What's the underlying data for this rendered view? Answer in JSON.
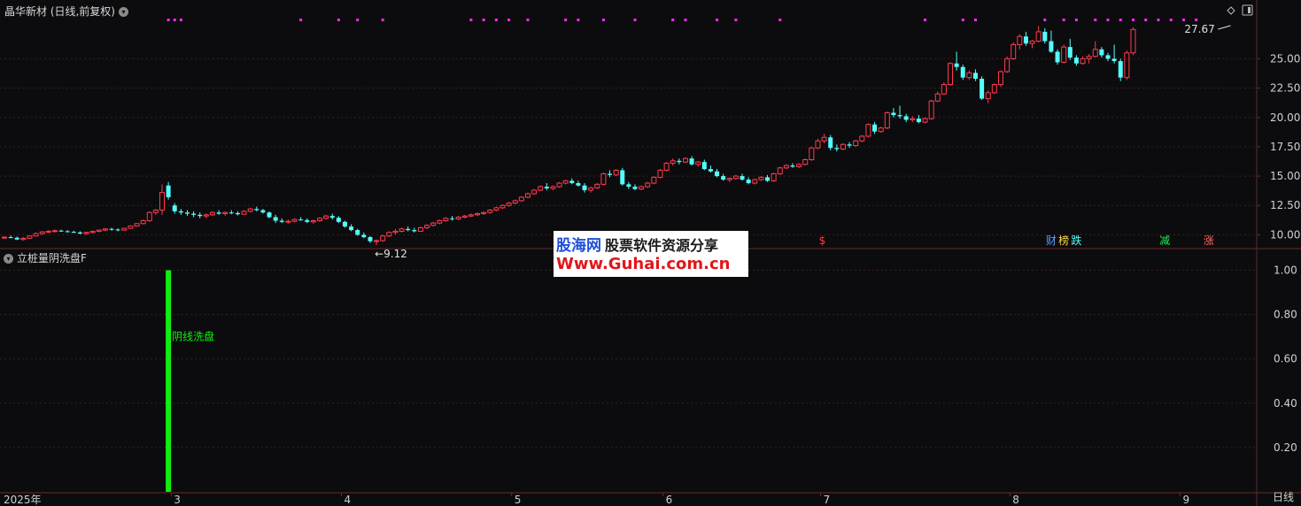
{
  "header": {
    "title": "晶华新材 (日线,前复权)",
    "indicator_title": "立桩量阴洗盘F"
  },
  "watermark": {
    "brand": "股海网",
    "tagline": "股票软件资源分享",
    "url": "Www.Guhai.com.cn"
  },
  "period_label": "日线",
  "colors": {
    "background": "#0c0c0e",
    "up": "#ff3b4e",
    "down": "#54ffff",
    "signal_dot": "#ff2bff",
    "indicator_bar": "#10f010",
    "grid": "#3a1e1e",
    "axis_text": "#d0d0d0"
  },
  "chart_data": [
    {
      "type": "candlestick",
      "title": "晶华新材 (日线,前复权)",
      "yticks": [
        10.0,
        12.5,
        15.0,
        17.5,
        20.0,
        22.5,
        25.0
      ],
      "ylim": [
        8.9,
        28.5
      ],
      "x_labels": [
        "2025年",
        "3",
        "4",
        "5",
        "6",
        "7",
        "8",
        "9"
      ],
      "x_label_index": [
        0,
        27,
        54,
        81,
        105,
        130,
        160,
        187
      ],
      "price_annotations": [
        {
          "text": "←9.12",
          "value": 9.12,
          "index": 59
        },
        {
          "text": "27.67",
          "value": 27.67,
          "index": 195
        }
      ],
      "event_markers": [
        {
          "text": "$",
          "index": 130,
          "color": "#ff3b3b"
        },
        {
          "text": "财",
          "index": 166,
          "color": "#5aa0ff"
        },
        {
          "text": "榜",
          "index": 168,
          "color": "#ffd84a"
        },
        {
          "text": "跌",
          "index": 170,
          "color": "#54ffff"
        },
        {
          "text": "减",
          "index": 184,
          "color": "#22ee55"
        },
        {
          "text": "涨",
          "index": 191,
          "color": "#ff6666"
        }
      ],
      "signal_dot_indices": [
        26,
        27,
        28,
        47,
        53,
        56,
        60,
        74,
        76,
        78,
        80,
        83,
        89,
        91,
        95,
        100,
        106,
        108,
        113,
        116,
        123,
        146,
        152,
        154,
        165,
        168,
        170,
        173,
        175,
        177,
        179,
        181,
        183,
        185,
        187,
        189
      ],
      "ohlc": [
        [
          9.75,
          9.85,
          9.65,
          9.8
        ],
        [
          9.8,
          9.95,
          9.7,
          9.75
        ],
        [
          9.75,
          9.85,
          9.55,
          9.6
        ],
        [
          9.6,
          9.8,
          9.5,
          9.7
        ],
        [
          9.7,
          9.95,
          9.65,
          9.9
        ],
        [
          9.9,
          10.2,
          9.85,
          10.1
        ],
        [
          10.1,
          10.3,
          10.0,
          10.25
        ],
        [
          10.25,
          10.4,
          10.15,
          10.3
        ],
        [
          10.3,
          10.45,
          10.2,
          10.35
        ],
        [
          10.35,
          10.45,
          10.25,
          10.3
        ],
        [
          10.3,
          10.4,
          10.2,
          10.25
        ],
        [
          10.25,
          10.35,
          10.15,
          10.2
        ],
        [
          10.2,
          10.3,
          10.05,
          10.1
        ],
        [
          10.1,
          10.25,
          10.0,
          10.2
        ],
        [
          10.2,
          10.35,
          10.1,
          10.3
        ],
        [
          10.3,
          10.45,
          10.2,
          10.4
        ],
        [
          10.4,
          10.55,
          10.3,
          10.5
        ],
        [
          10.5,
          10.6,
          10.35,
          10.45
        ],
        [
          10.45,
          10.55,
          10.3,
          10.4
        ],
        [
          10.4,
          10.6,
          10.35,
          10.55
        ],
        [
          10.55,
          10.8,
          10.5,
          10.75
        ],
        [
          10.75,
          11.0,
          10.7,
          10.95
        ],
        [
          10.95,
          11.3,
          10.9,
          11.2
        ],
        [
          11.2,
          12.0,
          11.1,
          11.9
        ],
        [
          11.9,
          12.2,
          11.7,
          12.1
        ],
        [
          12.1,
          14.3,
          11.7,
          13.6
        ],
        [
          14.2,
          14.5,
          13.0,
          13.2
        ],
        [
          12.5,
          12.7,
          11.8,
          12.0
        ],
        [
          12.0,
          12.2,
          11.7,
          11.9
        ],
        [
          11.9,
          12.1,
          11.6,
          11.8
        ],
        [
          11.8,
          12.0,
          11.5,
          11.7
        ],
        [
          11.7,
          11.9,
          11.4,
          11.6
        ],
        [
          11.6,
          11.8,
          11.4,
          11.7
        ],
        [
          11.7,
          12.0,
          11.6,
          11.9
        ],
        [
          11.9,
          12.1,
          11.7,
          11.8
        ],
        [
          11.8,
          12.0,
          11.6,
          11.9
        ],
        [
          11.9,
          12.1,
          11.75,
          11.85
        ],
        [
          11.85,
          12.0,
          11.65,
          11.75
        ],
        [
          11.75,
          12.1,
          11.7,
          12.0
        ],
        [
          12.0,
          12.3,
          11.9,
          12.2
        ],
        [
          12.2,
          12.4,
          12.0,
          12.1
        ],
        [
          12.1,
          12.2,
          11.8,
          11.9
        ],
        [
          11.9,
          12.0,
          11.4,
          11.5
        ],
        [
          11.5,
          11.7,
          11.0,
          11.2
        ],
        [
          11.2,
          11.4,
          11.0,
          11.1
        ],
        [
          11.1,
          11.3,
          10.95,
          11.15
        ],
        [
          11.15,
          11.4,
          11.05,
          11.3
        ],
        [
          11.3,
          11.5,
          11.2,
          11.25
        ],
        [
          11.25,
          11.4,
          11.0,
          11.1
        ],
        [
          11.1,
          11.3,
          10.95,
          11.2
        ],
        [
          11.2,
          11.5,
          11.1,
          11.4
        ],
        [
          11.4,
          11.7,
          11.3,
          11.6
        ],
        [
          11.6,
          11.8,
          11.3,
          11.45
        ],
        [
          11.45,
          11.6,
          11.0,
          11.1
        ],
        [
          11.1,
          11.2,
          10.6,
          10.7
        ],
        [
          10.7,
          10.9,
          10.3,
          10.4
        ],
        [
          10.4,
          10.5,
          9.9,
          10.0
        ],
        [
          10.0,
          10.2,
          9.7,
          9.8
        ],
        [
          9.8,
          9.9,
          9.3,
          9.45
        ],
        [
          9.45,
          9.6,
          9.12,
          9.5
        ],
        [
          9.5,
          10.0,
          9.4,
          9.9
        ],
        [
          9.9,
          10.3,
          9.8,
          10.2
        ],
        [
          10.2,
          10.5,
          10.0,
          10.3
        ],
        [
          10.3,
          10.6,
          10.2,
          10.5
        ],
        [
          10.5,
          10.7,
          10.3,
          10.4
        ],
        [
          10.4,
          10.6,
          10.2,
          10.3
        ],
        [
          10.3,
          10.7,
          10.25,
          10.6
        ],
        [
          10.6,
          10.9,
          10.5,
          10.8
        ],
        [
          10.8,
          11.1,
          10.7,
          11.0
        ],
        [
          11.0,
          11.3,
          10.9,
          11.2
        ],
        [
          11.2,
          11.5,
          11.1,
          11.4
        ],
        [
          11.4,
          11.6,
          11.2,
          11.35
        ],
        [
          11.35,
          11.6,
          11.25,
          11.5
        ],
        [
          11.5,
          11.7,
          11.4,
          11.6
        ],
        [
          11.6,
          11.8,
          11.5,
          11.7
        ],
        [
          11.7,
          11.9,
          11.6,
          11.8
        ],
        [
          11.8,
          12.0,
          11.7,
          11.9
        ],
        [
          11.9,
          12.2,
          11.8,
          12.1
        ],
        [
          12.1,
          12.4,
          12.0,
          12.3
        ],
        [
          12.3,
          12.6,
          12.2,
          12.5
        ],
        [
          12.5,
          12.8,
          12.4,
          12.7
        ],
        [
          12.7,
          13.0,
          12.6,
          12.9
        ],
        [
          12.9,
          13.3,
          12.8,
          13.2
        ],
        [
          13.2,
          13.6,
          13.1,
          13.5
        ],
        [
          13.5,
          13.9,
          13.4,
          13.8
        ],
        [
          13.8,
          14.2,
          13.7,
          14.1
        ],
        [
          14.1,
          14.4,
          13.8,
          13.95
        ],
        [
          13.95,
          14.2,
          13.8,
          14.1
        ],
        [
          14.1,
          14.5,
          14.0,
          14.4
        ],
        [
          14.4,
          14.7,
          14.3,
          14.6
        ],
        [
          14.6,
          14.8,
          14.3,
          14.4
        ],
        [
          14.4,
          14.6,
          14.1,
          14.2
        ],
        [
          14.2,
          14.4,
          13.6,
          13.8
        ],
        [
          13.8,
          14.1,
          13.6,
          14.0
        ],
        [
          14.0,
          14.4,
          13.9,
          14.3
        ],
        [
          14.3,
          15.3,
          14.2,
          15.2
        ],
        [
          15.2,
          15.5,
          14.9,
          15.1
        ],
        [
          15.1,
          15.6,
          15.0,
          15.5
        ],
        [
          15.5,
          15.7,
          14.2,
          14.3
        ],
        [
          14.3,
          14.5,
          13.9,
          14.1
        ],
        [
          14.1,
          14.3,
          13.8,
          13.9
        ],
        [
          13.9,
          14.2,
          13.8,
          14.1
        ],
        [
          14.1,
          14.5,
          14.0,
          14.4
        ],
        [
          14.4,
          15.0,
          14.3,
          14.9
        ],
        [
          14.9,
          15.6,
          14.8,
          15.5
        ],
        [
          15.5,
          16.2,
          15.4,
          16.1
        ],
        [
          16.1,
          16.5,
          15.9,
          16.3
        ],
        [
          16.3,
          16.5,
          16.0,
          16.2
        ],
        [
          16.2,
          16.6,
          16.1,
          16.5
        ],
        [
          16.5,
          16.7,
          15.9,
          16.0
        ],
        [
          16.0,
          16.3,
          15.8,
          16.2
        ],
        [
          16.2,
          16.4,
          15.5,
          15.6
        ],
        [
          15.6,
          15.9,
          15.3,
          15.4
        ],
        [
          15.4,
          15.6,
          14.9,
          15.0
        ],
        [
          15.0,
          15.2,
          14.6,
          14.7
        ],
        [
          14.7,
          14.9,
          14.5,
          14.8
        ],
        [
          14.8,
          15.1,
          14.7,
          15.0
        ],
        [
          15.0,
          15.2,
          14.6,
          14.7
        ],
        [
          14.7,
          14.9,
          14.3,
          14.4
        ],
        [
          14.4,
          14.8,
          14.3,
          14.7
        ],
        [
          14.7,
          15.0,
          14.6,
          14.9
        ],
        [
          14.9,
          15.1,
          14.5,
          14.6
        ],
        [
          14.6,
          15.3,
          14.5,
          15.2
        ],
        [
          15.2,
          15.8,
          15.1,
          15.7
        ],
        [
          15.7,
          16.0,
          15.6,
          15.9
        ],
        [
          15.9,
          16.1,
          15.7,
          15.8
        ],
        [
          15.8,
          16.1,
          15.7,
          16.0
        ],
        [
          16.0,
          16.5,
          15.9,
          16.4
        ],
        [
          16.4,
          17.5,
          16.3,
          17.4
        ],
        [
          17.4,
          18.2,
          17.3,
          18.0
        ],
        [
          18.0,
          18.6,
          17.8,
          18.3
        ],
        [
          18.3,
          18.5,
          17.2,
          17.4
        ],
        [
          17.4,
          17.7,
          17.1,
          17.3
        ],
        [
          17.3,
          17.8,
          17.2,
          17.7
        ],
        [
          17.7,
          17.9,
          17.4,
          17.6
        ],
        [
          17.6,
          18.1,
          17.5,
          18.0
        ],
        [
          18.0,
          18.5,
          17.9,
          18.4
        ],
        [
          18.4,
          19.5,
          18.3,
          19.4
        ],
        [
          19.4,
          19.6,
          18.6,
          18.8
        ],
        [
          18.8,
          19.2,
          18.7,
          19.1
        ],
        [
          19.1,
          20.5,
          19.0,
          20.4
        ],
        [
          20.4,
          20.8,
          20.0,
          20.2
        ],
        [
          20.2,
          21.0,
          19.9,
          20.1
        ],
        [
          20.1,
          20.3,
          19.6,
          19.8
        ],
        [
          19.8,
          20.1,
          19.6,
          19.9
        ],
        [
          19.9,
          20.2,
          19.5,
          19.6
        ],
        [
          19.6,
          20.0,
          19.5,
          19.9
        ],
        [
          19.9,
          21.5,
          19.8,
          21.4
        ],
        [
          21.4,
          22.2,
          21.3,
          22.0
        ],
        [
          22.0,
          23.0,
          21.9,
          22.8
        ],
        [
          22.8,
          24.7,
          22.7,
          24.6
        ],
        [
          24.6,
          25.6,
          24.0,
          24.3
        ],
        [
          24.3,
          24.5,
          23.2,
          23.4
        ],
        [
          23.4,
          24.0,
          23.2,
          23.8
        ],
        [
          23.8,
          24.1,
          23.1,
          23.3
        ],
        [
          23.3,
          23.5,
          21.5,
          21.6
        ],
        [
          21.6,
          22.3,
          21.2,
          22.1
        ],
        [
          22.1,
          22.9,
          22.0,
          22.8
        ],
        [
          22.8,
          24.0,
          22.6,
          23.9
        ],
        [
          23.9,
          25.2,
          23.8,
          25.0
        ],
        [
          25.0,
          26.4,
          24.9,
          26.2
        ],
        [
          26.2,
          27.1,
          25.8,
          26.9
        ],
        [
          26.9,
          27.3,
          26.1,
          26.3
        ],
        [
          26.3,
          26.6,
          25.9,
          26.5
        ],
        [
          26.5,
          27.8,
          26.4,
          27.3
        ],
        [
          27.3,
          27.6,
          26.3,
          26.5
        ],
        [
          26.5,
          27.4,
          25.5,
          25.6
        ],
        [
          25.6,
          25.8,
          24.5,
          24.7
        ],
        [
          24.7,
          26.2,
          24.6,
          26.0
        ],
        [
          26.0,
          26.7,
          24.9,
          25.1
        ],
        [
          25.1,
          25.3,
          24.4,
          24.6
        ],
        [
          24.6,
          25.2,
          24.5,
          25.0
        ],
        [
          25.0,
          25.4,
          24.6,
          25.2
        ],
        [
          25.2,
          26.5,
          25.1,
          25.8
        ],
        [
          25.8,
          26.0,
          25.1,
          25.3
        ],
        [
          25.3,
          25.5,
          24.8,
          25.0
        ],
        [
          25.0,
          26.2,
          24.6,
          24.8
        ],
        [
          24.8,
          25.0,
          23.1,
          23.4
        ],
        [
          23.4,
          25.7,
          23.2,
          25.5
        ],
        [
          25.5,
          27.67,
          25.3,
          27.5
        ]
      ]
    },
    {
      "type": "bar",
      "title": "立桩量阴洗盘F",
      "yticks": [
        0.2,
        0.4,
        0.6,
        0.8,
        1.0
      ],
      "ylim": [
        0,
        1.05
      ],
      "bars": [
        {
          "index": 26,
          "value": 1.0
        }
      ],
      "annotation": {
        "text": "阴线洗盘",
        "index": 26,
        "value": 0.7
      }
    }
  ]
}
